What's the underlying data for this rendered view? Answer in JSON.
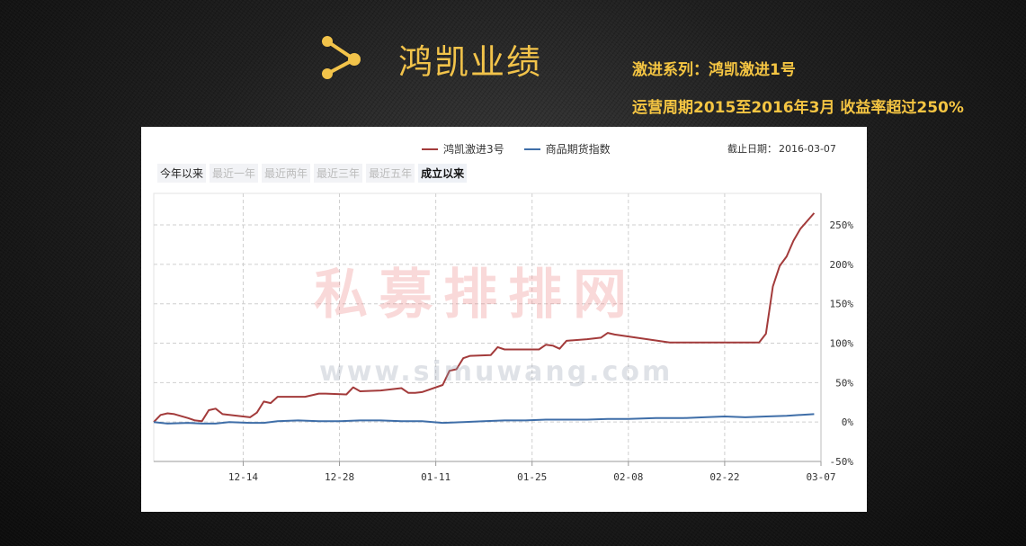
{
  "header": {
    "title": "鸿凯业绩",
    "subtitle1": "激进系列：鸿凯激进1号",
    "subtitle2": "运营周期2015至2016年3月  收益率超过250%",
    "icon": "share-network-icon",
    "accent": "#f5c542"
  },
  "chart_panel": {
    "legend": [
      {
        "name": "鸿凯激进3号",
        "color": "#a33b3b"
      },
      {
        "name": "商品期货指数",
        "color": "#3f6ea8"
      }
    ],
    "asof_label": "截止日期：",
    "asof_date": "2016-03-07",
    "tabs": [
      {
        "label": "今年以来",
        "state": "normal"
      },
      {
        "label": "最近一年",
        "state": "disabled"
      },
      {
        "label": "最近两年",
        "state": "disabled"
      },
      {
        "label": "最近三年",
        "state": "disabled"
      },
      {
        "label": "最近五年",
        "state": "disabled"
      },
      {
        "label": "成立以来",
        "state": "selected"
      }
    ],
    "watermark_cn": "私募排排网",
    "watermark_url": "www.simuwang.com"
  },
  "chart_data": {
    "type": "line",
    "xlabel": "",
    "ylabel": "",
    "x_ticks": [
      "12-14",
      "12-28",
      "01-11",
      "01-25",
      "02-08",
      "02-22",
      "03-07"
    ],
    "x_domain": [
      "2015-12-01",
      "2016-03-07"
    ],
    "y_ticks": [
      "-50%",
      "0%",
      "50%",
      "100%",
      "150%",
      "200%",
      "250%"
    ],
    "ylim": [
      -50,
      290
    ],
    "grid": true,
    "series": [
      {
        "name": "鸿凯激进3号",
        "color": "#a33b3b",
        "points": [
          [
            "2015-12-01",
            0
          ],
          [
            "2015-12-02",
            9
          ],
          [
            "2015-12-03",
            11
          ],
          [
            "2015-12-04",
            10
          ],
          [
            "2015-12-06",
            5
          ],
          [
            "2015-12-07",
            2
          ],
          [
            "2015-12-08",
            1
          ],
          [
            "2015-12-09",
            15
          ],
          [
            "2015-12-10",
            17
          ],
          [
            "2015-12-11",
            10
          ],
          [
            "2015-12-14",
            7
          ],
          [
            "2015-12-15",
            6
          ],
          [
            "2015-12-16",
            12
          ],
          [
            "2015-12-17",
            26
          ],
          [
            "2015-12-18",
            24
          ],
          [
            "2015-12-19",
            32
          ],
          [
            "2015-12-23",
            32
          ],
          [
            "2015-12-25",
            36
          ],
          [
            "2015-12-26",
            36
          ],
          [
            "2015-12-29",
            35
          ],
          [
            "2015-12-30",
            44
          ],
          [
            "2015-12-31",
            39
          ],
          [
            "2016-01-03",
            40
          ],
          [
            "2016-01-06",
            43
          ],
          [
            "2016-01-07",
            37
          ],
          [
            "2016-01-08",
            37
          ],
          [
            "2016-01-09",
            38
          ],
          [
            "2016-01-12",
            47
          ],
          [
            "2016-01-13",
            65
          ],
          [
            "2016-01-14",
            67
          ],
          [
            "2016-01-15",
            81
          ],
          [
            "2016-01-16",
            84
          ],
          [
            "2016-01-19",
            85
          ],
          [
            "2016-01-20",
            95
          ],
          [
            "2016-01-21",
            92
          ],
          [
            "2016-01-23",
            92
          ],
          [
            "2016-01-26",
            92
          ],
          [
            "2016-01-27",
            98
          ],
          [
            "2016-01-28",
            97
          ],
          [
            "2016-01-29",
            93
          ],
          [
            "2016-01-30",
            103
          ],
          [
            "2016-02-02",
            105
          ],
          [
            "2016-02-04",
            107
          ],
          [
            "2016-02-05",
            113
          ],
          [
            "2016-02-06",
            111
          ],
          [
            "2016-02-14",
            101
          ],
          [
            "2016-02-20",
            101
          ],
          [
            "2016-02-25",
            101
          ],
          [
            "2016-02-26",
            101
          ],
          [
            "2016-02-27",
            101
          ],
          [
            "2016-02-28",
            112
          ],
          [
            "2016-02-29",
            172
          ],
          [
            "2016-03-01",
            198
          ],
          [
            "2016-03-02",
            210
          ],
          [
            "2016-03-03",
            230
          ],
          [
            "2016-03-04",
            245
          ],
          [
            "2016-03-06",
            265
          ]
        ]
      },
      {
        "name": "商品期货指数",
        "color": "#3f6ea8",
        "points": [
          [
            "2015-12-01",
            0
          ],
          [
            "2015-12-03",
            -2
          ],
          [
            "2015-12-06",
            -1
          ],
          [
            "2015-12-08",
            -2
          ],
          [
            "2015-12-10",
            -2
          ],
          [
            "2015-12-12",
            0
          ],
          [
            "2015-12-15",
            -1
          ],
          [
            "2015-12-17",
            -1
          ],
          [
            "2015-12-19",
            1
          ],
          [
            "2015-12-22",
            2
          ],
          [
            "2015-12-25",
            1
          ],
          [
            "2015-12-28",
            1
          ],
          [
            "2015-12-31",
            2
          ],
          [
            "2016-01-03",
            2
          ],
          [
            "2016-01-06",
            1
          ],
          [
            "2016-01-09",
            1
          ],
          [
            "2016-01-12",
            -1
          ],
          [
            "2016-01-15",
            0
          ],
          [
            "2016-01-18",
            1
          ],
          [
            "2016-01-21",
            2
          ],
          [
            "2016-01-24",
            2
          ],
          [
            "2016-01-27",
            3
          ],
          [
            "2016-01-30",
            3
          ],
          [
            "2016-02-02",
            3
          ],
          [
            "2016-02-05",
            4
          ],
          [
            "2016-02-08",
            4
          ],
          [
            "2016-02-12",
            5
          ],
          [
            "2016-02-16",
            5
          ],
          [
            "2016-02-19",
            6
          ],
          [
            "2016-02-22",
            7
          ],
          [
            "2016-02-25",
            6
          ],
          [
            "2016-02-28",
            7
          ],
          [
            "2016-03-02",
            8
          ],
          [
            "2016-03-06",
            10
          ]
        ]
      }
    ]
  }
}
